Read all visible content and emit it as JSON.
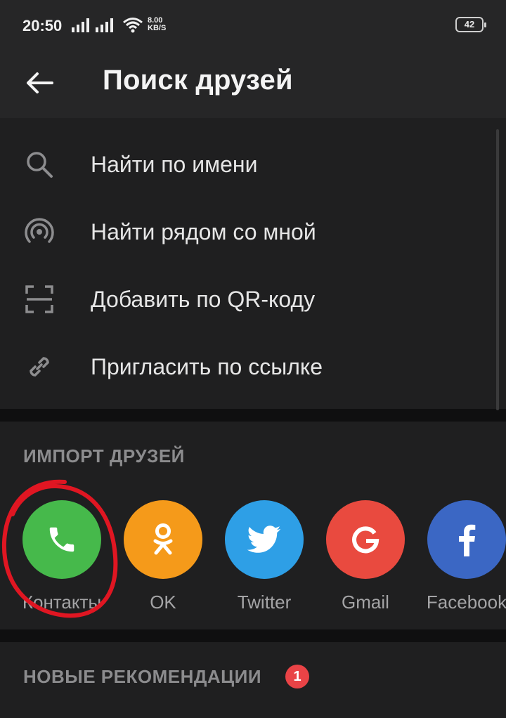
{
  "status_bar": {
    "time": "20:50",
    "net_speed_value": "8.00",
    "net_speed_unit": "KB/S",
    "battery": "42"
  },
  "app_bar": {
    "title": "Поиск друзей",
    "back_icon": "arrow-left-icon"
  },
  "menu": {
    "items": [
      {
        "label": "Найти по имени",
        "icon": "search-icon"
      },
      {
        "label": "Найти рядом со мной",
        "icon": "nearby-signal-icon"
      },
      {
        "label": "Добавить по QR-коду",
        "icon": "qr-scan-icon"
      },
      {
        "label": "Пригласить по ссылке",
        "icon": "link-icon"
      }
    ]
  },
  "import": {
    "header": "ИМПОРТ ДРУЗЕЙ",
    "items": [
      {
        "label": "Контакты",
        "icon": "phone-icon",
        "color": "#46b94b"
      },
      {
        "label": "OK",
        "icon": "odnoklassniki-icon",
        "color": "#f59a1a"
      },
      {
        "label": "Twitter",
        "icon": "twitter-bird-icon",
        "color": "#2e9fe6"
      },
      {
        "label": "Gmail",
        "icon": "google-g-icon",
        "color": "#e94a3f"
      },
      {
        "label": "Facebook",
        "icon": "facebook-f-icon",
        "color": "#3b67c4"
      }
    ]
  },
  "recommendations": {
    "header": "НОВЫЕ РЕКОМЕНДАЦИИ",
    "badge_count": "1"
  },
  "colors": {
    "background": "#0f0f10",
    "card": "#1f1f20",
    "app_bar": "#262627",
    "annotation": "#e01622",
    "badge": "#e94346"
  }
}
